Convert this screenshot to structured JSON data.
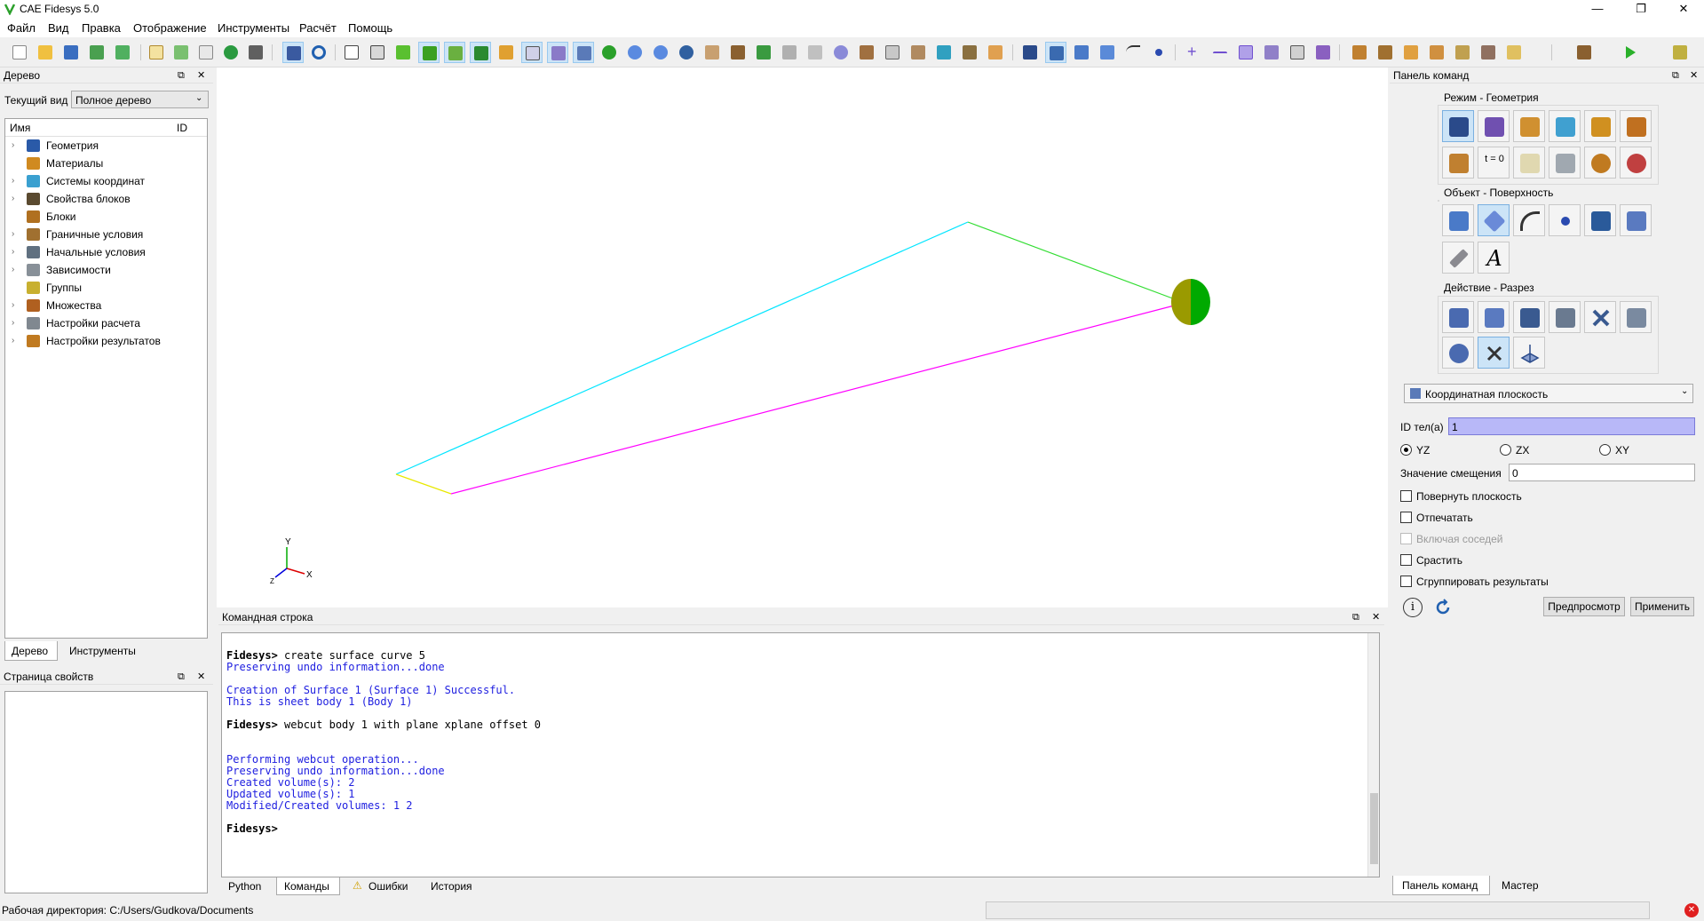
{
  "app": {
    "title": "CAE Fidesys 5.0"
  },
  "window_controls": {
    "minimize": "—",
    "restore": "❐",
    "close": "✕"
  },
  "menu": [
    "Файл",
    "Вид",
    "Правка",
    "Отображение",
    "Инструменты",
    "Расчёт",
    "Помощь"
  ],
  "tree_panel": {
    "title": "Дерево",
    "view_label": "Текущий вид",
    "view_value": "Полное дерево",
    "col_name": "Имя",
    "col_id": "ID",
    "items": [
      {
        "label": "Геометрия",
        "expandable": true,
        "color": "#2a5aa8"
      },
      {
        "label": "Материалы",
        "expandable": false,
        "color": "#d08a20"
      },
      {
        "label": "Системы координат",
        "expandable": true,
        "color": "#3aa0d0"
      },
      {
        "label": "Свойства блоков",
        "expandable": true,
        "color": "#5a4a30"
      },
      {
        "label": "Блоки",
        "expandable": false,
        "color": "#b07020"
      },
      {
        "label": "Граничные условия",
        "expandable": true,
        "color": "#a07030"
      },
      {
        "label": "Начальные условия",
        "expandable": true,
        "color": "#607080"
      },
      {
        "label": "Зависимости",
        "expandable": true,
        "color": "#889098"
      },
      {
        "label": "Группы",
        "expandable": false,
        "color": "#c8b030"
      },
      {
        "label": "Множества",
        "expandable": true,
        "color": "#b06020"
      },
      {
        "label": "Настройки расчета",
        "expandable": true,
        "color": "#808890"
      },
      {
        "label": "Настройки результатов",
        "expandable": true,
        "color": "#c07a20"
      }
    ],
    "tabs": [
      "Дерево",
      "Инструменты"
    ]
  },
  "properties_panel": {
    "title": "Страница свойств"
  },
  "viewport": {
    "axes": {
      "y": "Y",
      "x": "X",
      "z": "Z"
    },
    "colors": {
      "cyan": "#00e5ff",
      "green": "#33dd33",
      "magenta": "#ff00ff",
      "yellow": "#ffff00",
      "disk_green": "#00aa00",
      "disk_olive": "#9a9a00"
    }
  },
  "command_panel": {
    "title": "Командная строка",
    "lines": [
      {
        "type": "prompt",
        "prefix": "Fidesys>",
        "text": " create surface curve 5"
      },
      {
        "type": "out",
        "text": "Preserving undo information...done"
      },
      {
        "type": "blank",
        "text": ""
      },
      {
        "type": "out",
        "text": "Creation of Surface 1 (Surface 1) Successful."
      },
      {
        "type": "out",
        "text": "This is sheet body 1 (Body 1)"
      },
      {
        "type": "blank",
        "text": ""
      },
      {
        "type": "prompt",
        "prefix": "Fidesys>",
        "text": " webcut body 1 with plane xplane offset 0"
      },
      {
        "type": "blank",
        "text": ""
      },
      {
        "type": "blank",
        "text": ""
      },
      {
        "type": "out",
        "text": "Performing webcut operation..."
      },
      {
        "type": "out",
        "text": "Preserving undo information...done"
      },
      {
        "type": "out",
        "text": "Created volume(s): 2"
      },
      {
        "type": "out",
        "text": "Updated volume(s): 1"
      },
      {
        "type": "out",
        "text": "Modified/Created volumes: 1 2"
      },
      {
        "type": "blank",
        "text": ""
      },
      {
        "type": "prompt",
        "prefix": "Fidesys>",
        "text": ""
      }
    ],
    "tabs": [
      "Python",
      "Команды",
      "Ошибки",
      "История"
    ]
  },
  "right_panel": {
    "title": "Панель команд",
    "groups": {
      "mode": "Режим - Геометрия",
      "object": "Объект - Поверхность",
      "action": "Действие - Разрез"
    },
    "t0_label": "t = 0",
    "text_icon_label": "A",
    "combo_value": "Координатная плоскость",
    "ids_label": "ID тел(а)",
    "ids_value": "1",
    "planes": [
      "YZ",
      "ZX",
      "XY"
    ],
    "selected_plane": "YZ",
    "offset_label": "Значение смещения",
    "offset_value": "0",
    "checkboxes": [
      {
        "label": "Повернуть плоскость",
        "enabled": true
      },
      {
        "label": "Отпечатать",
        "enabled": true
      },
      {
        "label": "Включая соседей",
        "enabled": false
      },
      {
        "label": "Срастить",
        "enabled": true
      },
      {
        "label": "Сгруппировать результаты",
        "enabled": true
      }
    ],
    "preview_btn": "Предпросмотр",
    "apply_btn": "Применить",
    "info_glyph": "i",
    "tabs": [
      "Панель команд",
      "Мастер"
    ]
  },
  "status_bar": {
    "text": "Рабочая директория: C:/Users/Gudkova/Documents"
  }
}
